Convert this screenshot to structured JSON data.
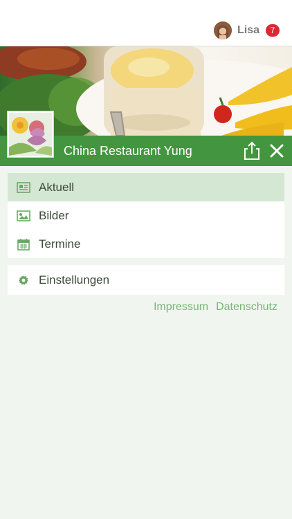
{
  "user": {
    "name": "Lisa",
    "notifications": "7"
  },
  "restaurant": {
    "title": "China Restaurant Yung"
  },
  "menu": {
    "items": [
      {
        "label": "Aktuell",
        "icon": "newspaper-icon",
        "active": true
      },
      {
        "label": "Bilder",
        "icon": "image-icon",
        "active": false
      },
      {
        "label": "Termine",
        "icon": "calendar-icon",
        "active": false
      }
    ],
    "settings": {
      "label": "Einstellungen",
      "icon": "gear-icon"
    }
  },
  "footer_links": {
    "impressum": "Impressum",
    "datenschutz": "Datenschutz"
  },
  "colors": {
    "brand_green": "#43963f",
    "active_item": "#d4e7d2",
    "link_green": "#7ab477",
    "badge_red": "#e02633",
    "page_bg": "#f0f6ef"
  }
}
